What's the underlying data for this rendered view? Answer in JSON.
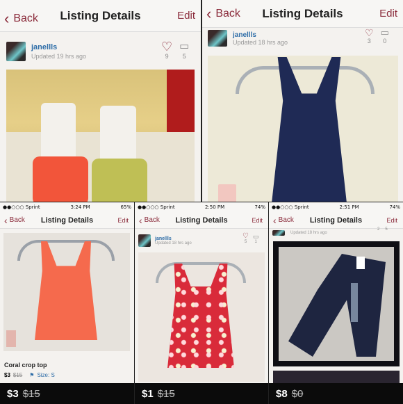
{
  "panels": {
    "top_left": {
      "back": "Back",
      "title": "Listing Details",
      "edit": "Edit",
      "username": "janellls",
      "updated": "Updated 19 hrs ago",
      "likes": "9",
      "comments": "5"
    },
    "top_right": {
      "back": "Back",
      "title": "Listing Details",
      "edit": "Edit",
      "username": "janellls",
      "updated": "Updated 18 hrs ago",
      "likes": "3",
      "comments": "0"
    },
    "bottom_left": {
      "status": {
        "carrier": "●●○○○ Sprint",
        "time": "3:24 PM",
        "battery": "65%"
      },
      "back": "Back",
      "title": "Listing Details",
      "edit": "Edit",
      "item_title": "Coral crop top",
      "price": "$3",
      "old_price": "$15",
      "size": "Size: S"
    },
    "bottom_mid": {
      "status": {
        "carrier": "●●○○○ Sprint",
        "time": "2:50 PM",
        "battery": "74%"
      },
      "back": "Back",
      "title": "Listing Details",
      "edit": "Edit",
      "username": "janellls",
      "updated": "Updated 18 hrs ago",
      "likes": "5",
      "comments": "1"
    },
    "bottom_right": {
      "status": {
        "carrier": "●●○○○ Sprint",
        "time": "2:51 PM",
        "battery": "74%"
      },
      "back": "Back",
      "title": "Listing Details",
      "edit": "Edit",
      "updated": "Updated 18 hrs ago",
      "likes": "2",
      "comments": "5"
    }
  },
  "prices": [
    {
      "price": "$3",
      "old": "$15"
    },
    {
      "price": "$1",
      "old": "$15"
    },
    {
      "price": "$8",
      "old": "$0"
    }
  ],
  "colors": {
    "accent": "#8a2a3a",
    "username": "#2f6ea8"
  }
}
